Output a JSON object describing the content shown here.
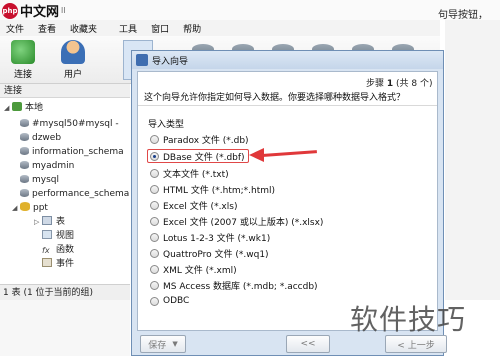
{
  "header": {
    "logo_badge": "php",
    "logo_text": "中文网",
    "logo_suffix": "ll",
    "right_hint": "句导按钮，"
  },
  "menu": [
    "文件",
    "查看",
    "收藏夹",
    "工具",
    "窗口",
    "帮助"
  ],
  "toolbar": {
    "connect_label": "连接",
    "user_label": "用户"
  },
  "nav": {
    "header": "连接",
    "host": "本地",
    "databases": [
      "#mysql50#mysql -",
      "dzweb",
      "information_schema",
      "myadmin",
      "mysql",
      "performance_schema",
      "ppt"
    ],
    "children": [
      {
        "label": "表",
        "icon": "table-icon"
      },
      {
        "label": "视图",
        "icon": "view-icon"
      },
      {
        "label": "函数",
        "icon": "function-icon"
      },
      {
        "label": "事件",
        "icon": "event-icon"
      }
    ]
  },
  "status": "1 表 (1 位于当前的组)",
  "dialog": {
    "title": "导入向导",
    "step_prefix": "步骤",
    "step_current": "1",
    "step_suffix": "(共 8 个)",
    "intro": "这个向导允许你指定如何导入数据。你要选择哪种数据导入格式？",
    "group_label": "导入类型",
    "options": [
      "Paradox 文件 (*.db)",
      "DBase 文件 (*.dbf)",
      "文本文件 (*.txt)",
      "HTML 文件 (*.htm;*.html)",
      "Excel 文件 (*.xls)",
      "Excel 文件 (2007 或以上版本) (*.xlsx)",
      "Lotus 1-2-3 文件 (*.wk1)",
      "QuattroPro 文件 (*.wq1)",
      "XML 文件 (*.xml)",
      "MS Access 数据库 (*.mdb; *.accdb)",
      "ODBC"
    ],
    "selected_index": 1,
    "save_label": "保存",
    "nav_first_label": "<<",
    "prev_label": "< 上一步",
    "accent_color": "#e0383a"
  },
  "watermark": "软件技巧"
}
